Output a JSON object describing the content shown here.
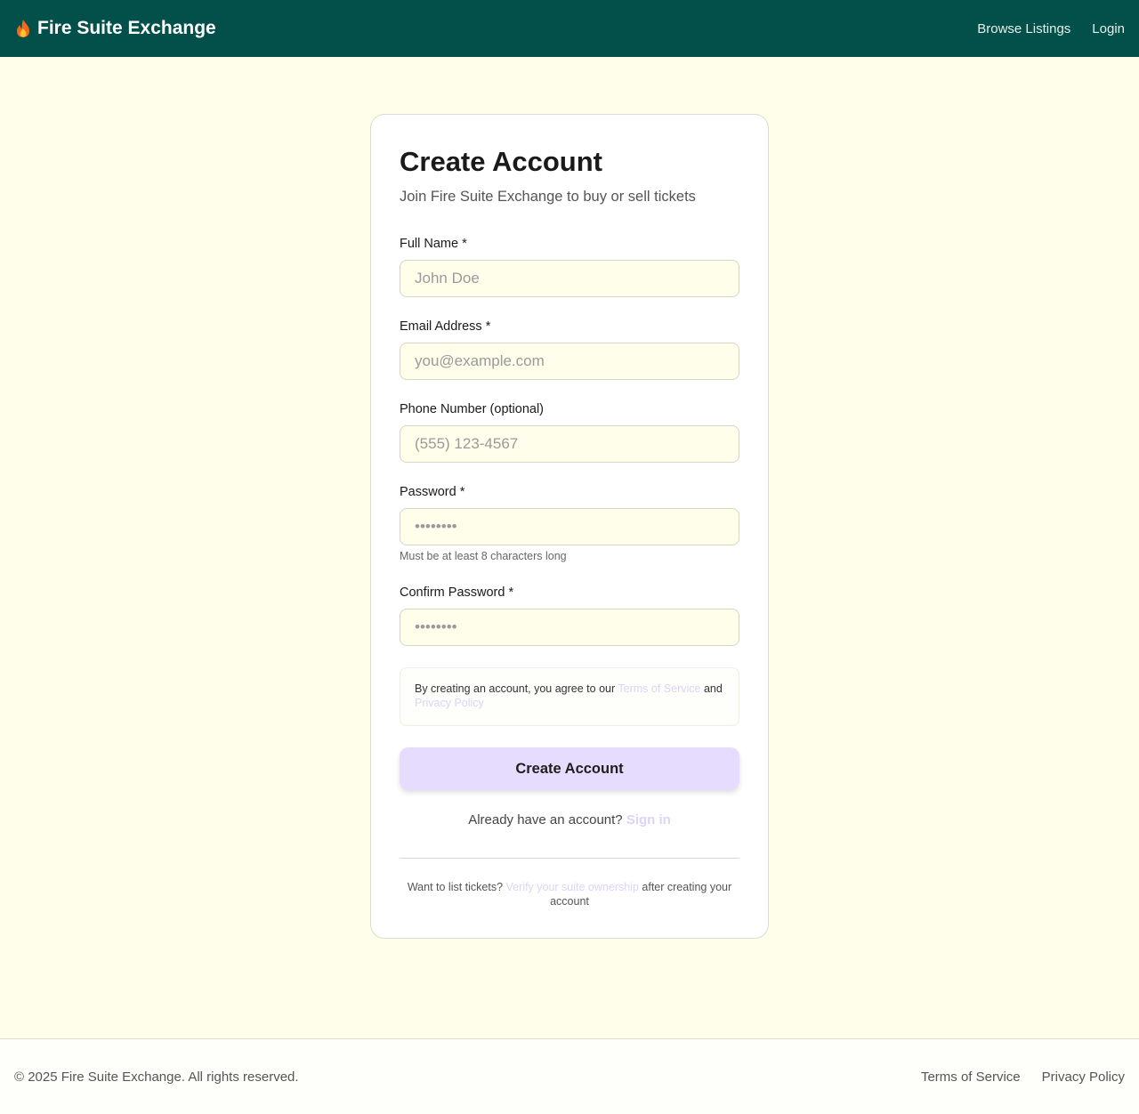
{
  "header": {
    "brand_icon": "flame-icon",
    "brand_name": "Fire Suite Exchange",
    "nav": [
      {
        "label": "Browse Listings"
      },
      {
        "label": "Login"
      }
    ]
  },
  "form": {
    "title": "Create Account",
    "subtitle": "Join Fire Suite Exchange to buy or sell tickets",
    "fields": {
      "full_name": {
        "label": "Full Name *",
        "placeholder": "John Doe",
        "value": ""
      },
      "email": {
        "label": "Email Address *",
        "placeholder": "you@example.com",
        "value": ""
      },
      "phone": {
        "label": "Phone Number (optional)",
        "placeholder": "(555) 123-4567",
        "value": ""
      },
      "password": {
        "label": "Password *",
        "placeholder": "••••••••",
        "hint": "Must be at least 8 characters long"
      },
      "confirm_password": {
        "label": "Confirm Password *",
        "placeholder": "••••••••"
      }
    },
    "terms": {
      "prefix": "By creating an account, you agree to our ",
      "terms_link": "Terms of Service",
      "middle": " and ",
      "privacy_link": "Privacy Policy"
    },
    "submit_label": "Create Account",
    "signin": {
      "prompt": "Already have an account? ",
      "link": "Sign in"
    },
    "list_note": {
      "prefix": "Want to list tickets? ",
      "link": "Verify your suite ownership",
      "suffix": " after creating your account"
    }
  },
  "footer": {
    "copyright": "© 2025 Fire Suite Exchange. All rights reserved.",
    "links": [
      {
        "label": "Terms of Service"
      },
      {
        "label": "Privacy Policy"
      }
    ]
  },
  "colors": {
    "header_bg": "#03504a",
    "page_bg": "#fefeeb",
    "button_bg": "#e6dcfd",
    "link_faint": "#dcd4f5"
  }
}
